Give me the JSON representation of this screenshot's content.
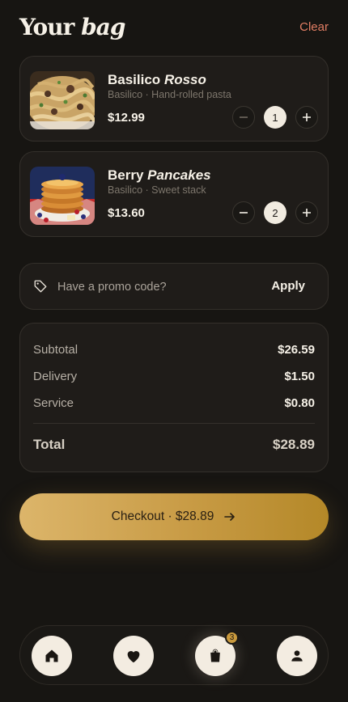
{
  "header": {
    "title_plain": "Your",
    "title_italic": "bag",
    "clear_label": "Clear"
  },
  "items": [
    {
      "name_plain": "Basilico",
      "name_italic": "Rosso",
      "subtitle": "Basilico · Hand-rolled pasta",
      "price": "$12.99",
      "quantity": "1",
      "image": "pasta-photo"
    },
    {
      "name_plain": "Berry",
      "name_italic": "Pancakes",
      "subtitle": "Basilico · Sweet stack",
      "price": "$13.60",
      "quantity": "2",
      "image": "pancakes-photo"
    }
  ],
  "promo": {
    "placeholder": "Have a promo code?",
    "apply_label": "Apply",
    "icon": "tag-icon"
  },
  "summary": {
    "subtotal_label": "Subtotal",
    "subtotal_value": "$26.59",
    "delivery_label": "Delivery",
    "delivery_value": "$1.50",
    "service_label": "Service",
    "service_value": "$0.80",
    "total_label": "Total",
    "total_value": "$28.89"
  },
  "checkout": {
    "label": "Checkout · $28.89",
    "icon": "arrow-right-icon"
  },
  "nav": {
    "items": [
      {
        "icon": "home-icon"
      },
      {
        "icon": "heart-icon"
      },
      {
        "icon": "shopping-bag-icon",
        "badge": "3",
        "active": true
      },
      {
        "icon": "user-icon"
      }
    ]
  },
  "colors": {
    "background": "#171512",
    "accent": "#e27e64",
    "gold": "#c89b45",
    "card": "#1f1c19"
  }
}
